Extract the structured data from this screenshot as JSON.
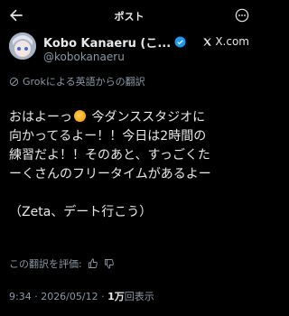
{
  "header": {
    "title": "ポスト"
  },
  "author": {
    "name": "Kobo Kanaeru (こ...",
    "handle": "@kobokanaeru",
    "xlink": "X.com"
  },
  "translation": {
    "label": "Grokによる英語からの翻訳"
  },
  "post": {
    "line1a": "おはよーっ",
    "line1b": " 今ダンススタジオに",
    "rest": "向かってるよー！！今日は2時間の\n練習だよ！！そのあと、すっごくた\nーくさんのフリータイムがあるよー\n\n（Zeta、デート行こう）"
  },
  "rating": {
    "label": "この翻訳を評価:"
  },
  "meta": {
    "time": "9:34 · 2026/05/12 · ",
    "views_count": "1万",
    "views_label": "回表示"
  },
  "colors": {
    "background": "#000000",
    "text": "#e7e9ea",
    "muted": "#8b98a5",
    "verified": "#1d9bf0"
  }
}
